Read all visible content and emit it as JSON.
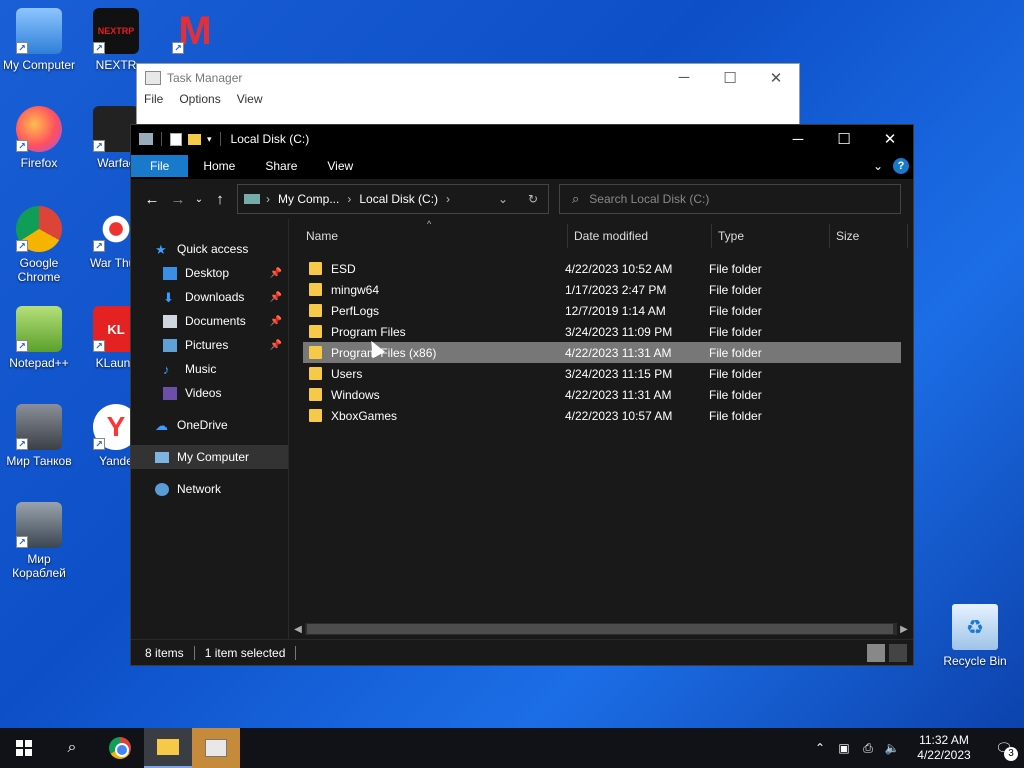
{
  "desktop": {
    "icons_left": [
      {
        "label": "My Computer"
      },
      {
        "label": "Firefox"
      },
      {
        "label": "Google Chrome"
      },
      {
        "label": "Notepad++"
      },
      {
        "label": "Мир Танков"
      },
      {
        "label": "Мир Кораблей"
      }
    ],
    "icons_second": [
      {
        "label": "NEXTR"
      },
      {
        "label": "Warfac"
      },
      {
        "label": "War Thun"
      },
      {
        "label": "KLaunc"
      },
      {
        "label": "Yande"
      }
    ],
    "recycle_bin": "Recycle Bin",
    "nextrp_logo_text": "NEXTRP"
  },
  "taskmgr": {
    "title": "Task Manager",
    "menu": [
      "File",
      "Options",
      "View"
    ]
  },
  "explorer": {
    "title": "Local Disk (C:)",
    "ribbon_tabs": [
      "File",
      "Home",
      "Share",
      "View"
    ],
    "help": "?",
    "breadcrumb": [
      "My Comp...",
      "Local Disk (C:)"
    ],
    "search_placeholder": "Search Local Disk (C:)",
    "nav": {
      "quick_access": "Quick access",
      "pinned": [
        "Desktop",
        "Downloads",
        "Documents",
        "Pictures"
      ],
      "unpinned": [
        "Music",
        "Videos"
      ],
      "onedrive": "OneDrive",
      "my_computer": "My Computer",
      "network": "Network"
    },
    "columns": {
      "name": "Name",
      "date": "Date modified",
      "type": "Type",
      "size": "Size"
    },
    "rows": [
      {
        "name": "ESD",
        "date": "4/22/2023 10:52 AM",
        "type": "File folder"
      },
      {
        "name": "mingw64",
        "date": "1/17/2023 2:47 PM",
        "type": "File folder"
      },
      {
        "name": "PerfLogs",
        "date": "12/7/2019 1:14 AM",
        "type": "File folder"
      },
      {
        "name": "Program Files",
        "date": "3/24/2023 11:09 PM",
        "type": "File folder"
      },
      {
        "name": "Program Files (x86)",
        "date": "4/22/2023 11:31 AM",
        "type": "File folder"
      },
      {
        "name": "Users",
        "date": "3/24/2023 11:15 PM",
        "type": "File folder"
      },
      {
        "name": "Windows",
        "date": "4/22/2023 11:31 AM",
        "type": "File folder"
      },
      {
        "name": "XboxGames",
        "date": "4/22/2023 10:57 AM",
        "type": "File folder"
      }
    ],
    "status_items": "8 items",
    "status_selected": "1 item selected"
  },
  "taskbar": {
    "time": "11:32 AM",
    "date": "4/22/2023",
    "notifications": "3"
  }
}
